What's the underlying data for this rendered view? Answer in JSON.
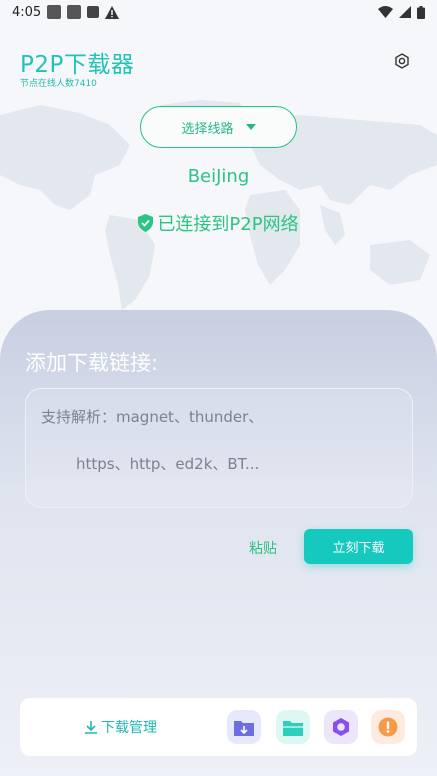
{
  "status_bar": {
    "time": "4:05"
  },
  "app": {
    "title": "P2P下载器",
    "subtitle": "节点在线人数7410"
  },
  "route": {
    "label": "选择线路"
  },
  "location": "BeiJing",
  "connection_status": "已连接到P2P网络",
  "download_panel": {
    "title": "添加下载链接:",
    "input_hint_line1": "支持解析：magnet、thunder、",
    "input_hint_line2": "https、http、ed2k、BT..."
  },
  "actions": {
    "paste": "粘贴",
    "download_now": "立刻下载"
  },
  "bottom_bar": {
    "download_manager": "下载管理",
    "icons": [
      "folder-download-icon",
      "folder-icon",
      "settings-hex-icon",
      "alert-icon"
    ]
  },
  "colors": {
    "accent": "#16c9be",
    "green": "#2cc383",
    "panel": "#c7cfe1"
  }
}
